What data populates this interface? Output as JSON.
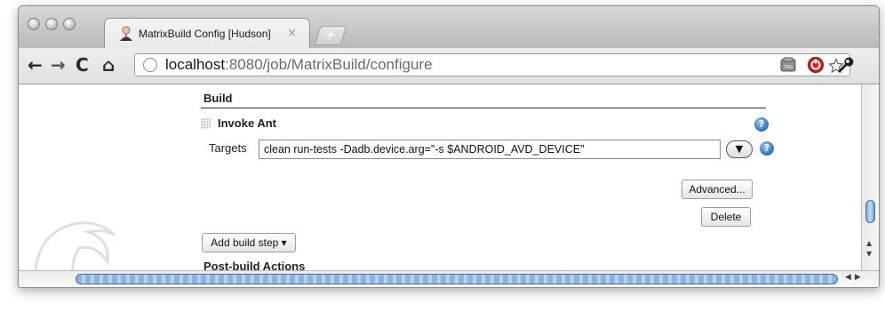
{
  "browser": {
    "tab": {
      "title": "MatrixBuild Config [Hudson]",
      "close_glyph": "×"
    },
    "new_tab_glyph": "+",
    "nav": {
      "back": "←",
      "forward": "→",
      "reload": "C",
      "home": "⌂"
    },
    "address": {
      "host": "localhost",
      "path": ":8080/job/MatrixBuild/configure"
    },
    "toolbar_icons": [
      "cookie-icon",
      "star-icon",
      "tag-icon",
      "stop-extension-icon",
      "wrench-icon"
    ]
  },
  "page": {
    "section_title": "Build",
    "step": {
      "title": "Invoke Ant",
      "targets_label": "Targets",
      "targets_value": "clean run-tests -Dadb.device.arg=\"-s $ANDROID_AVD_DEVICE\"",
      "expand_glyph": "▼",
      "help_glyph": "?"
    },
    "buttons": {
      "advanced": "Advanced...",
      "delete": "Delete",
      "add_build_step": "Add build step ▾"
    },
    "post_build_title": "Post-build Actions"
  },
  "colors": {
    "accent_blue": "#2e6fc0",
    "stop_red": "#d42020"
  }
}
